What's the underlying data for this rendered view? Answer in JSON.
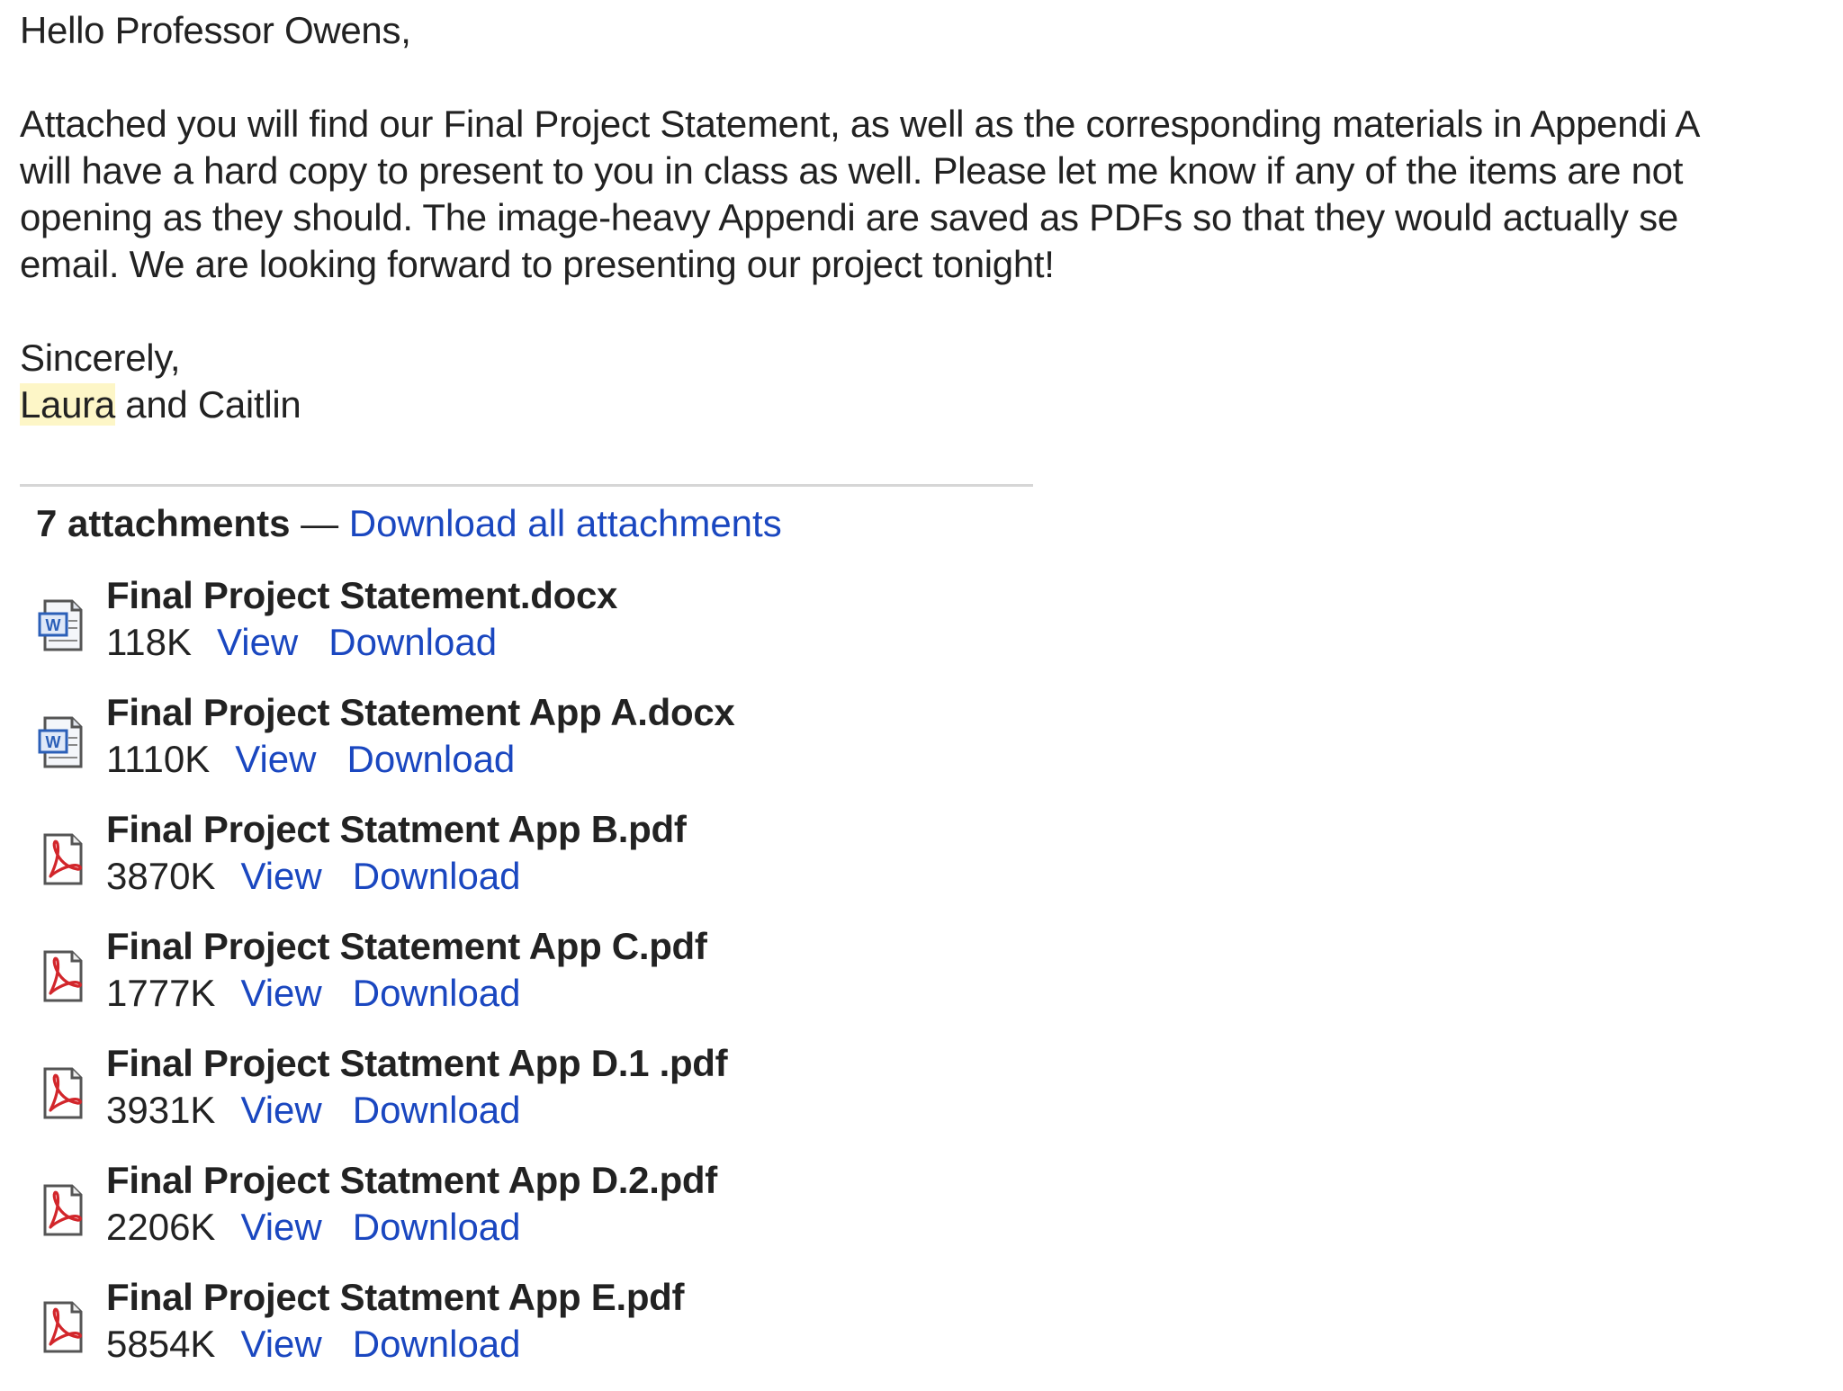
{
  "email": {
    "greeting": "Hello Professor Owens,",
    "paragraph_lines": [
      "Attached you will find our Final Project Statement, as well as the corresponding materials in Appendi A",
      "will have a hard copy to present to you in class as well.  Please let me know if any of the items are not",
      "opening as they should.  The image-heavy Appendi are saved as PDFs so that they would actually se",
      "email.  We are looking forward to presenting our project tonight!"
    ],
    "closing": "Sincerely,",
    "signature_highlight": "Laura",
    "signature_rest": " and Caitlin"
  },
  "attachments": {
    "count_label": "7 attachments",
    "separator": " — ",
    "download_all_label": "Download all attachments",
    "view_label": "View",
    "download_label": "Download",
    "items": [
      {
        "name": "Final Project Statement.docx",
        "size": "118K",
        "icon": "word-doc-icon"
      },
      {
        "name": "Final Project Statement App A.docx",
        "size": "1110K",
        "icon": "word-doc-icon"
      },
      {
        "name": "Final Project Statment App B.pdf",
        "size": "3870K",
        "icon": "pdf-icon"
      },
      {
        "name": "Final Project Statement App C.pdf",
        "size": "1777K",
        "icon": "pdf-icon"
      },
      {
        "name": "Final Project Statment App D.1 .pdf",
        "size": "3931K",
        "icon": "pdf-icon"
      },
      {
        "name": "Final Project Statment App D.2.pdf",
        "size": "2206K",
        "icon": "pdf-icon"
      },
      {
        "name": "Final Project Statment App E.pdf",
        "size": "5854K",
        "icon": "pdf-icon"
      }
    ]
  },
  "colors": {
    "link": "#1a47c0",
    "text": "#222222",
    "highlight": "#fdf6c7",
    "pdf_red": "#d2262b",
    "word_blue": "#2b5fb8"
  }
}
